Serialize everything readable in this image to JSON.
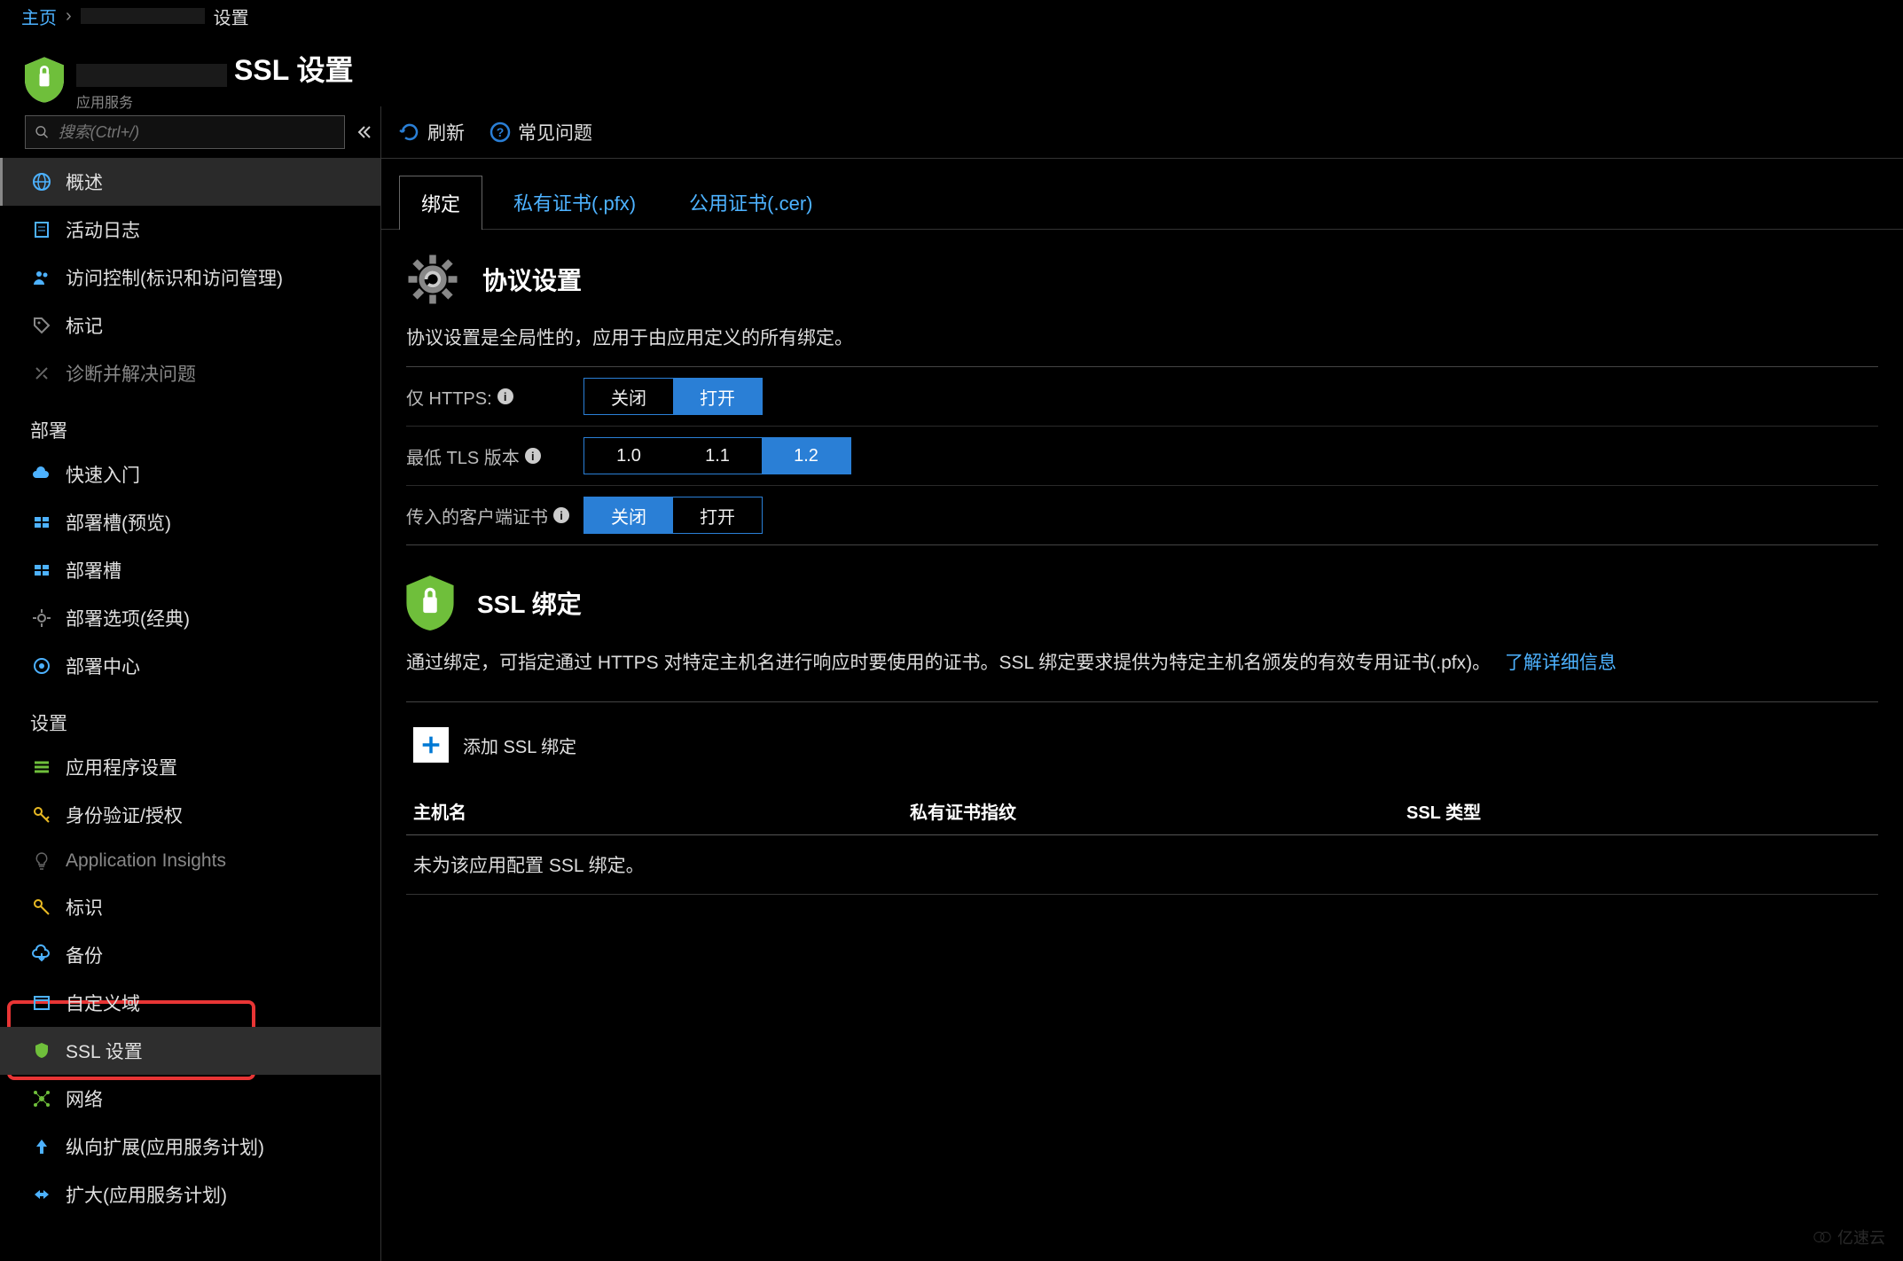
{
  "breadcrumb": {
    "home": "主页",
    "trail": "设置"
  },
  "header": {
    "title": "SSL 设置",
    "subtitle": "应用服务"
  },
  "search": {
    "placeholder": "搜索(Ctrl+/)"
  },
  "sidebar": {
    "items_top": [
      {
        "label": "概述",
        "name": "sidebar-item-overview",
        "icon": "globe",
        "selected": true
      },
      {
        "label": "活动日志",
        "name": "sidebar-item-activity-log",
        "icon": "log"
      },
      {
        "label": "访问控制(标识和访问管理)",
        "name": "sidebar-item-access-control",
        "icon": "iam"
      },
      {
        "label": "标记",
        "name": "sidebar-item-tags",
        "icon": "tag"
      },
      {
        "label": "诊断并解决问题",
        "name": "sidebar-item-diagnose",
        "icon": "tools",
        "dim": true
      }
    ],
    "group_deploy_label": "部署",
    "items_deploy": [
      {
        "label": "快速入门",
        "name": "sidebar-item-quickstart",
        "icon": "cloud"
      },
      {
        "label": "部署槽(预览)",
        "name": "sidebar-item-slots-preview",
        "icon": "slots"
      },
      {
        "label": "部署槽",
        "name": "sidebar-item-slots",
        "icon": "slots"
      },
      {
        "label": "部署选项(经典)",
        "name": "sidebar-item-deploy-options",
        "icon": "gear"
      },
      {
        "label": "部署中心",
        "name": "sidebar-item-deploy-center",
        "icon": "center"
      }
    ],
    "group_settings_label": "设置",
    "items_settings": [
      {
        "label": "应用程序设置",
        "name": "sidebar-item-app-settings",
        "icon": "appset"
      },
      {
        "label": "身份验证/授权",
        "name": "sidebar-item-auth",
        "icon": "key"
      },
      {
        "label": "Application Insights",
        "name": "sidebar-item-app-insights",
        "icon": "bulb",
        "dim": true
      },
      {
        "label": "标识",
        "name": "sidebar-item-identity",
        "icon": "key2"
      },
      {
        "label": "备份",
        "name": "sidebar-item-backup",
        "icon": "backup"
      },
      {
        "label": "自定义域",
        "name": "sidebar-item-custom-domain",
        "icon": "domain"
      },
      {
        "label": "SSL 设置",
        "name": "sidebar-item-ssl-settings",
        "icon": "shield",
        "active": true
      },
      {
        "label": "网络",
        "name": "sidebar-item-network",
        "icon": "network"
      },
      {
        "label": "纵向扩展(应用服务计划)",
        "name": "sidebar-item-scale-up",
        "icon": "scaleup"
      },
      {
        "label": "扩大(应用服务计划)",
        "name": "sidebar-item-scale-out",
        "icon": "scaleout"
      }
    ]
  },
  "toolbar": {
    "refresh": "刷新",
    "faq": "常见问题"
  },
  "tabs": [
    {
      "label": "绑定",
      "name": "tab-bindings",
      "active": true
    },
    {
      "label": "私有证书(.pfx)",
      "name": "tab-private-cert"
    },
    {
      "label": "公用证书(.cer)",
      "name": "tab-public-cert"
    }
  ],
  "protocol": {
    "heading": "协议设置",
    "desc": "协议设置是全局性的，应用于由应用定义的所有绑定。",
    "rows": {
      "https_only": {
        "label": "仅 HTTPS:",
        "off": "关闭",
        "on": "打开",
        "value": "on"
      },
      "tls_min": {
        "label": "最低 TLS 版本",
        "options": [
          "1.0",
          "1.1",
          "1.2"
        ],
        "value": "1.2"
      },
      "client_cert": {
        "label": "传入的客户端证书",
        "off": "关闭",
        "on": "打开",
        "value": "off"
      }
    }
  },
  "ssl_binding": {
    "heading": "SSL 绑定",
    "desc": "通过绑定，可指定通过 HTTPS 对特定主机名进行响应时要使用的证书。SSL 绑定要求提供为特定主机名颁发的有效专用证书(.pfx)。",
    "link": "了解详细信息",
    "add_label": "添加 SSL 绑定",
    "columns": {
      "host": "主机名",
      "thumbprint": "私有证书指纹",
      "type": "SSL 类型"
    },
    "empty": "未为该应用配置 SSL 绑定。"
  },
  "watermark": "亿速云"
}
